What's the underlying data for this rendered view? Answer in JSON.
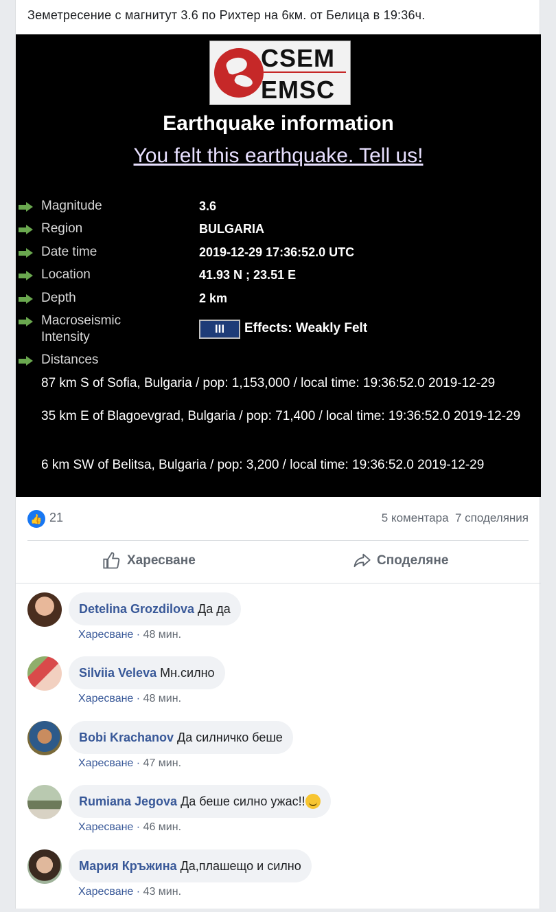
{
  "post": {
    "text": "Земетресение с магнитут 3.6 по Рихтер на 6км. от Белица в 19:36ч."
  },
  "quake": {
    "logo_line1": "CSEM",
    "logo_line2": "EMSC",
    "title": "Earthquake information",
    "felt_link": "You felt this earthquake. Tell us!",
    "fields": [
      {
        "label": "Magnitude",
        "value": "3.6"
      },
      {
        "label": "Region",
        "value": "BULGARIA"
      },
      {
        "label": "Date time",
        "value": "2019-12-29 17:36:52.0 UTC"
      },
      {
        "label": "Location",
        "value": "41.93 N ; 23.51 E"
      },
      {
        "label": "Depth",
        "value": "2 km"
      }
    ],
    "intensity_label_1": "Macroseismic",
    "intensity_label_2": "Intensity",
    "intensity_level": "III",
    "intensity_effects": "Effects: Weakly Felt",
    "distances_label": "Distances",
    "distances": [
      "87 km S of Sofia, Bulgaria / pop: 1,153,000 / local time: 19:36:52.0 2019-12-29",
      "35 km E of Blagoevgrad, Bulgaria / pop: 71,400 / local time: 19:36:52.0 2019-12-29",
      "6 km SW of Belitsa, Bulgaria / pop: 3,200 / local time: 19:36:52.0 2019-12-29"
    ]
  },
  "stats": {
    "likes": "21",
    "comments": "5 коментара",
    "shares": "7 споделяния"
  },
  "actions": {
    "like": "Харесване",
    "share": "Споделяне"
  },
  "comments": [
    {
      "name": "Detelina Grozdilova",
      "text": "Да да",
      "like": "Харесване",
      "time": "48 мин."
    },
    {
      "name": "Silviia Veleva",
      "text": "Мн.силно",
      "like": "Харесване",
      "time": "48 мин."
    },
    {
      "name": "Bobi Krachanov",
      "text": "Да силничко беше",
      "like": "Харесване",
      "time": "47 мин."
    },
    {
      "name": "Rumiana Jegova",
      "text": "Да беше силно ужас!!",
      "like": "Харесване",
      "time": "46 мин."
    },
    {
      "name": "Мария Кръжина",
      "text": "Да,плашещо и силно",
      "like": "Харесване",
      "time": "43 мин."
    }
  ]
}
